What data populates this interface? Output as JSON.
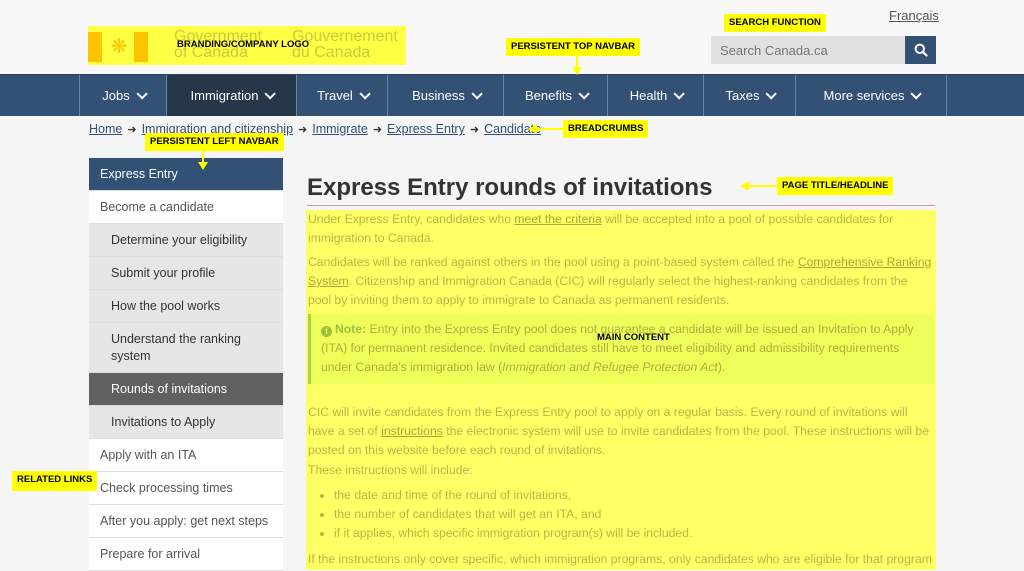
{
  "header": {
    "logo": {
      "gov_en_line1": "Government",
      "gov_en_line2": "of Canada",
      "gov_fr_line1": "Gouvernement",
      "gov_fr_line2": "du Canada",
      "icon": "maple-leaf-icon"
    },
    "language_link": "Français",
    "search": {
      "placeholder": "Search Canada.ca",
      "button_icon": "search-icon"
    }
  },
  "nav": {
    "items": [
      {
        "label": "Jobs"
      },
      {
        "label": "Immigration",
        "active": true
      },
      {
        "label": "Travel"
      },
      {
        "label": "Business"
      },
      {
        "label": "Benefits"
      },
      {
        "label": "Health"
      },
      {
        "label": "Taxes"
      },
      {
        "label": "More services"
      }
    ]
  },
  "breadcrumb": [
    "Home",
    "Immigration and citizenship",
    "Immigrate",
    "Express Entry",
    "Candidate"
  ],
  "sidenav": {
    "heading": "Express Entry",
    "items": [
      {
        "label": "Become a candidate",
        "level": "top"
      },
      {
        "label": "Determine your eligibility",
        "level": "sub"
      },
      {
        "label": "Submit your profile",
        "level": "sub"
      },
      {
        "label": "How the pool works",
        "level": "sub"
      },
      {
        "label": "Understand the ranking system",
        "level": "sub"
      },
      {
        "label": "Rounds of invitations",
        "level": "current"
      },
      {
        "label": "Invitations to Apply",
        "level": "sub"
      },
      {
        "label": "Apply with an ITA",
        "level": "top"
      },
      {
        "label": "Check processing times",
        "level": "top"
      },
      {
        "label": "After you apply: get next steps",
        "level": "top"
      },
      {
        "label": "Prepare for arrival",
        "level": "top"
      }
    ]
  },
  "main": {
    "title": "Express Entry rounds of invitations",
    "p1_before": "Under Express Entry, candidates who ",
    "p1_link": "meet the criteria",
    "p1_after": " will be accepted into a pool of possible candidates for immigration to Canada.",
    "p2_before": "Candidates will be ranked against others in the pool using a point-based system called the ",
    "p2_link": "Comprehensive Ranking System",
    "p2_after": ". Citizenship and Immigration Canada (CIC) will regularly select the highest-ranking candidates from the pool by inviting them to apply to immigrate to Canada as permanent residents.",
    "note_label": "Note:",
    "note_text": " Entry into the Express Entry pool does not guarantee a candidate will be issued an Invitation to Apply (ITA) for permanent residence. Invited candidates still have to meet eligibility and admissibility requirements under Canada's immigration law (",
    "note_italic": "Immigration and Refugee Protection Act",
    "note_end": ").",
    "p3_before": "CIC will invite candidates from the Express Entry pool to apply on a regular basis. Every round of invitations will have a set of ",
    "p3_link": "instructions",
    "p3_after": " the electronic system will use to invite candidates from the pool. These instructions will be posted on this website before each round of invitations.",
    "p4": "These instructions will include:",
    "list": [
      "the date and time of the round of invitations,",
      "the number of candidates that will get an ITA, and",
      "if it applies, which specific immigration program(s) will be included."
    ],
    "p5": "If the instructions only cover specific, which immigration programs, only candidates who are eligible for that program will be"
  },
  "annotations": {
    "logo": "BRANDING/COMPANY LOGO",
    "search": "SEARCH FUNCTION",
    "topnav": "PERSISTENT TOP NAVBAR",
    "breadcrumbs": "BREADCRUMBS",
    "leftnav": "PERSISTENT LEFT NAVBAR",
    "title": "PAGE TITLE/HEADLINE",
    "main": "MAIN CONTENT",
    "related": "RELATED LINKS"
  },
  "colors": {
    "brand_blue": "#335075",
    "nav_active": "#26374a",
    "annotation_yellow": "#ffff00",
    "sidenav_current": "#606060"
  }
}
